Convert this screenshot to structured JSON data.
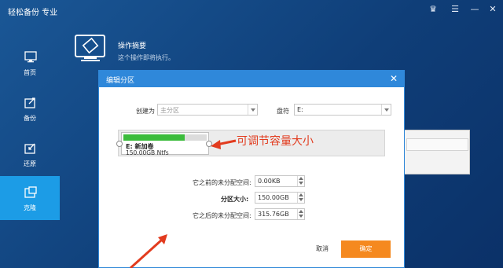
{
  "app": {
    "title": "轻松备份 专业",
    "controls": {
      "upgrade": "♛",
      "menu": "☰",
      "minimize": "—",
      "close": "✕"
    }
  },
  "sidebar": {
    "items": [
      {
        "label": "首页",
        "icon": "home-monitor-icon",
        "active": false
      },
      {
        "label": "备份",
        "icon": "backup-icon",
        "active": false
      },
      {
        "label": "还原",
        "icon": "restore-icon",
        "active": false
      },
      {
        "label": "克隆",
        "icon": "clone-icon",
        "active": true
      }
    ]
  },
  "operation": {
    "title": "操作摘要",
    "subtitle": "这个操作即将执行。"
  },
  "dialog": {
    "title": "编辑分区",
    "create_as_label": "创建为",
    "create_as_value": "主分区",
    "drive_letter_label": "盘符",
    "drive_letter_value": "E:",
    "partition": {
      "name": "E: 新加卷",
      "info": "150.00GB Ntfs",
      "usage_fraction": 0.74
    },
    "annotation": "可调节容量大小",
    "unalloc_before_label": "它之前的未分配空间:",
    "unalloc_before_value": "0.00KB",
    "partition_size_label": "分区大小:",
    "partition_size_value": "150.00GB",
    "unalloc_after_label": "它之后的未分配空间:",
    "unalloc_after_value": "315.76GB",
    "cancel_label": "取消",
    "ok_label": "确定"
  },
  "colors": {
    "background": "#0f3e78",
    "active_nav": "#1c9ce6",
    "dialog_header": "#2f88da",
    "ok_button": "#f5891f",
    "usage_bar": "#3cbc3c",
    "annotation": "#e23b1e"
  }
}
